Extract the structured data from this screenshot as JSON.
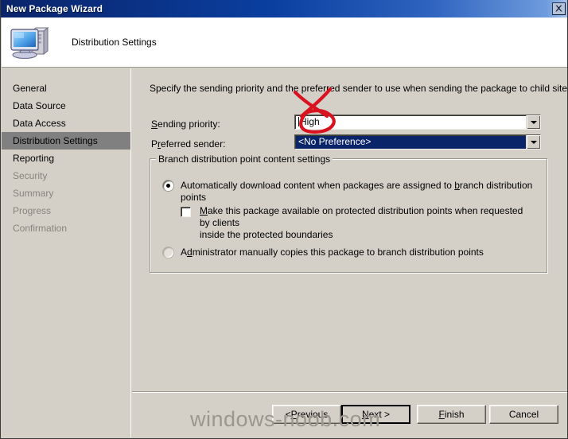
{
  "window": {
    "title": "New Package Wizard",
    "close_icon": "close-icon"
  },
  "header": {
    "title": "Distribution Settings",
    "icon": "computer-icon"
  },
  "sidebar": {
    "items": [
      {
        "label": "General",
        "state": "normal"
      },
      {
        "label": "Data Source",
        "state": "normal"
      },
      {
        "label": "Data Access",
        "state": "normal"
      },
      {
        "label": "Distribution Settings",
        "state": "selected"
      },
      {
        "label": "Reporting",
        "state": "normal"
      },
      {
        "label": "Security",
        "state": "disabled"
      },
      {
        "label": "Summary",
        "state": "disabled"
      },
      {
        "label": "Progress",
        "state": "disabled"
      },
      {
        "label": "Confirmation",
        "state": "disabled"
      }
    ]
  },
  "main": {
    "intro": "Specify the sending priority and the preferred sender to use when sending the package to child sites.",
    "sending_priority": {
      "label_pre": "S",
      "label_post": "ending priority:",
      "value": "High",
      "focused": true
    },
    "preferred_sender": {
      "label_pre": "P",
      "label_mid": "r",
      "label_post": "eferred sender:",
      "value": "<No Preference>",
      "selected": true
    },
    "group": {
      "title": "Branch distribution point content settings",
      "radio_auto": {
        "label_pre": "Automatically download content when packages are assigned to ",
        "label_accel": "b",
        "label_post": "ranch distribution points",
        "checked": true
      },
      "checkbox_protected": {
        "label_accel": "M",
        "label_line1_post": "ake this package available on protected distribution points when requested by clients",
        "label_line2": "inside the protected boundaries",
        "checked": false
      },
      "radio_manual": {
        "label_pre": "A",
        "label_accel": "d",
        "label_post": "ministrator manually copies this package to branch distribution points",
        "checked": false
      }
    }
  },
  "buttons": {
    "previous": {
      "pre": "< ",
      "accel": "P",
      "post": "revious"
    },
    "next": {
      "pre": "",
      "accel": "N",
      "post": "ext >",
      "is_default": true
    },
    "finish": {
      "pre": "",
      "accel": "F",
      "post": "inish"
    },
    "cancel": {
      "pre": "",
      "accel": "",
      "post": "Cancel"
    }
  },
  "watermark": {
    "text": "windows-noob.com"
  },
  "colors": {
    "titlebar_start": "#0a246a",
    "dialog_face": "#d4d0c8",
    "selection_blue": "#0a246a",
    "sidebar_highlight": "#808080",
    "annotation_red": "#d9121f",
    "disabled_text": "#87847d"
  }
}
